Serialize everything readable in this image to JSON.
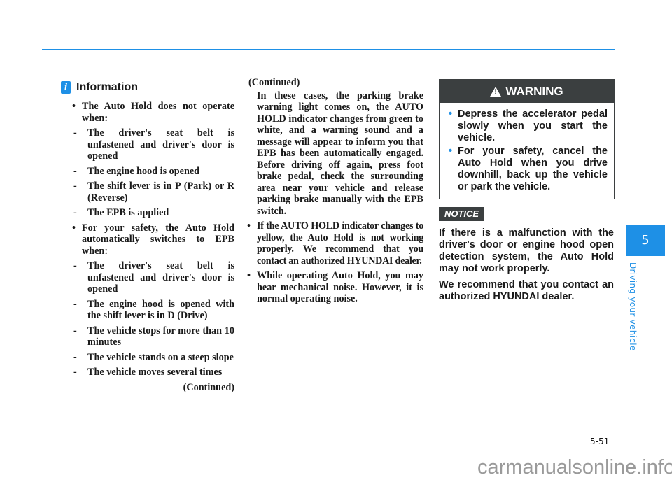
{
  "page": {
    "number": "5-51",
    "chapter_number": "5",
    "chapter_title": "Driving your vehicle",
    "watermark": "carmanualsonline.info",
    "accent_color": "#1e90e6"
  },
  "information": {
    "icon_glyph": "i",
    "title": "Information",
    "bullet1": {
      "text": "The Auto Hold does not operate when:",
      "subs": [
        "The driver's seat belt is unfastened and driver's door is opened",
        "The engine hood is opened",
        "The shift lever is in P (Park) or R (Reverse)",
        "The EPB is applied"
      ]
    },
    "bullet2": {
      "text": "For your safety, the Auto Hold automatically switches to EPB when:",
      "subs": [
        "The driver's seat belt is unfastened and driver's door is opened",
        "The engine hood is opened with the shift lever is in D (Drive)",
        "The vehicle stops for more than 10 minutes",
        "The vehicle stands on a steep slope",
        "The vehicle moves several times"
      ]
    },
    "continued": "(Continued)"
  },
  "column2": {
    "continued_head": "(Continued)",
    "paragraph": "In these cases, the parking brake warning light comes on, the AUTO HOLD indicator changes from green to white, and a warning sound and a message will appear to inform you that EPB has been automatically engaged. Before driving off again, press foot brake pedal, check the surrounding area near your vehicle and release parking brake manually with the EPB switch.",
    "bullets": [
      "If the AUTO HOLD indicator changes to yellow, the Auto Hold is not working properly. We recommend that you contact an authorized HYUNDAI dealer.",
      "While operating Auto Hold, you may hear mechanical noise. However, it is normal operating noise."
    ]
  },
  "warning": {
    "title": "WARNING",
    "items": [
      "Depress the accelerator pedal slowly when you start the vehicle.",
      "For your safety, cancel the Auto Hold when you drive downhill, back up the vehicle or park the vehicle."
    ]
  },
  "notice": {
    "label": "NOTICE",
    "paragraphs": [
      "If there is a malfunction with the driver's door or engine hood open detection system, the Auto Hold may not work properly.",
      "We recommend that you contact an authorized HYUNDAI dealer."
    ]
  }
}
